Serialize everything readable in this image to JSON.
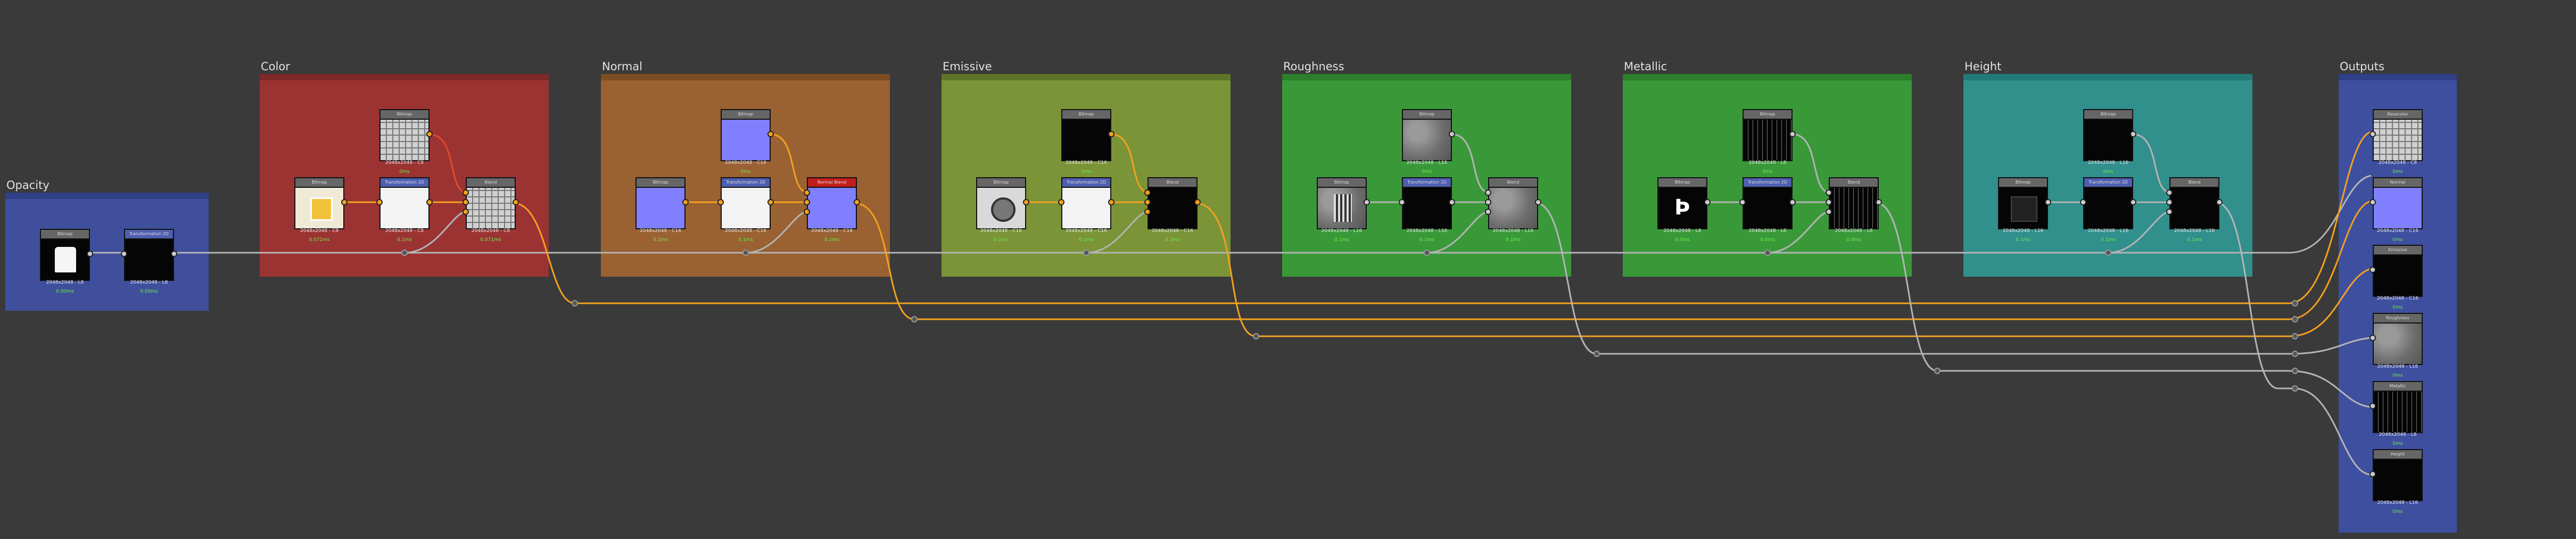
{
  "canvas": {
    "background": "#3a3a3a"
  },
  "frames": [
    {
      "id": "opacity",
      "title": "Opacity",
      "bar_color": "#2f3f88",
      "body_color": "#3f4f9c"
    },
    {
      "id": "color",
      "title": "Color",
      "bar_color": "#7d2727",
      "body_color": "#9c3333"
    },
    {
      "id": "normal",
      "title": "Normal",
      "bar_color": "#7e4c22",
      "body_color": "#9a6132"
    },
    {
      "id": "emissive",
      "title": "Emissive",
      "bar_color": "#5f7426",
      "body_color": "#7a9437"
    },
    {
      "id": "roughness",
      "title": "Roughness",
      "bar_color": "#2b7f2b",
      "body_color": "#399939"
    },
    {
      "id": "metallic",
      "title": "Metallic",
      "bar_color": "#2b7f2b",
      "body_color": "#399939"
    },
    {
      "id": "height",
      "title": "Height",
      "bar_color": "#227a78",
      "body_color": "#318f8c"
    },
    {
      "id": "outputs",
      "title": "Outputs",
      "bar_color": "#2f3f88",
      "body_color": "#3e4f9f"
    }
  ],
  "nodes": [
    {
      "id": "op_in",
      "header": "Bitmap",
      "res": "2048x2048 - L8",
      "time": "0.00ms",
      "texture": "white-shape"
    },
    {
      "id": "op_xf",
      "header": "Transformation 2D",
      "res": "2048x2048 - L8",
      "time": "0.00ms",
      "texture": "black"
    },
    {
      "id": "col_in",
      "header": "Bitmap",
      "res": "2048x2048 - C8",
      "time": "0.072ms",
      "texture": "yellow-tile"
    },
    {
      "id": "col_xf",
      "header": "Transformation 2D",
      "res": "2048x2048 - C8",
      "time": "0.1ms",
      "texture": "white"
    },
    {
      "id": "col_top",
      "header": "Bitmap",
      "res": "2048x2048 - C8",
      "time": "0ms",
      "texture": "checker"
    },
    {
      "id": "col_bl",
      "header": "Blend",
      "res": "2048x2048 - C8",
      "time": "0.071ms",
      "texture": "checker"
    },
    {
      "id": "nor_in",
      "header": "Bitmap",
      "res": "2048x2048 - C16",
      "time": "0.1ms",
      "texture": "blue"
    },
    {
      "id": "nor_xf",
      "header": "Transformation 2D",
      "res": "2048x2048 - C16",
      "time": "0.1ms",
      "texture": "white"
    },
    {
      "id": "nor_top",
      "header": "Bitmap",
      "res": "2048x2048 - C16",
      "time": "0ms",
      "texture": "blue"
    },
    {
      "id": "nor_bl",
      "header": "Normal Blend",
      "res": "2048x2048 - C16",
      "time": "0.1ms",
      "texture": "blue"
    },
    {
      "id": "emi_in",
      "header": "Bitmap",
      "res": "2048x2048 - C16",
      "time": "0.1ms",
      "texture": "round"
    },
    {
      "id": "emi_xf",
      "header": "Transformation 2D",
      "res": "2048x2048 - C16",
      "time": "0.1ms",
      "texture": "white"
    },
    {
      "id": "emi_top",
      "header": "Bitmap",
      "res": "2048x2048 - C16",
      "time": "0ms",
      "texture": "black"
    },
    {
      "id": "emi_bl",
      "header": "Blend",
      "res": "2048x2048 - C16",
      "time": "0.1ms",
      "texture": "black"
    },
    {
      "id": "rou_in",
      "header": "Bitmap",
      "res": "2048x2048 - L16",
      "time": "0.1ms",
      "texture": "noise"
    },
    {
      "id": "rou_xf",
      "header": "Transformation 2D",
      "res": "2048x2048 - L16",
      "time": "0.1ms",
      "texture": "black"
    },
    {
      "id": "rou_top",
      "header": "Bitmap",
      "res": "2048x2048 - L16",
      "time": "0ms",
      "texture": "noise"
    },
    {
      "id": "rou_bl",
      "header": "Blend",
      "res": "2048x2048 - L16",
      "time": "0.1ms",
      "texture": "noise"
    },
    {
      "id": "met_in",
      "header": "Bitmap",
      "res": "2048x2048 - L8",
      "time": "0.0ms",
      "texture": "logo"
    },
    {
      "id": "met_xf",
      "header": "Transformation 2D",
      "res": "2048x2048 - L8",
      "time": "0.0ms",
      "texture": "black"
    },
    {
      "id": "met_top",
      "header": "Bitmap",
      "res": "2048x2048 - L8",
      "time": "0ms",
      "texture": "grid-dark"
    },
    {
      "id": "met_bl",
      "header": "Blend",
      "res": "2048x2048 - L8",
      "time": "0.0ms",
      "texture": "grid-dark"
    },
    {
      "id": "hei_in",
      "header": "Bitmap",
      "res": "2048x2048 - L16",
      "time": "0.1ms",
      "texture": "dark-square"
    },
    {
      "id": "hei_xf",
      "header": "Transformation 2D",
      "res": "2048x2048 - L16",
      "time": "0.1ms",
      "texture": "black"
    },
    {
      "id": "hei_top",
      "header": "Bitmap",
      "res": "2048x2048 - L16",
      "time": "0ms",
      "texture": "black"
    },
    {
      "id": "hei_bl",
      "header": "Blend",
      "res": "2048x2048 - L16",
      "time": "0.1ms",
      "texture": "black"
    },
    {
      "id": "out_color",
      "header": "Basecolor",
      "res": "2048x2048 - C8",
      "time": "0ms",
      "texture": "checker"
    },
    {
      "id": "out_normal",
      "header": "Normal",
      "res": "2048x2048 - C16",
      "time": "0ms",
      "texture": "blue"
    },
    {
      "id": "out_emissive",
      "header": "Emissive",
      "res": "2048x2048 - C16",
      "time": "0ms",
      "texture": "black"
    },
    {
      "id": "out_rough",
      "header": "Roughness",
      "res": "2048x2048 - L16",
      "time": "0ms",
      "texture": "noise"
    },
    {
      "id": "out_metal",
      "header": "Metallic",
      "res": "2048x2048 - L8",
      "time": "0ms",
      "texture": "grid-dark"
    },
    {
      "id": "out_height",
      "header": "Height",
      "res": "2048x2048 - L16",
      "time": "0ms",
      "texture": "black"
    }
  ],
  "colors": {
    "wire_orange": "#f4a11e",
    "wire_grey": "#b4b4b4",
    "time_green": "#6cf04a",
    "selected_header": "#c21d1d"
  }
}
